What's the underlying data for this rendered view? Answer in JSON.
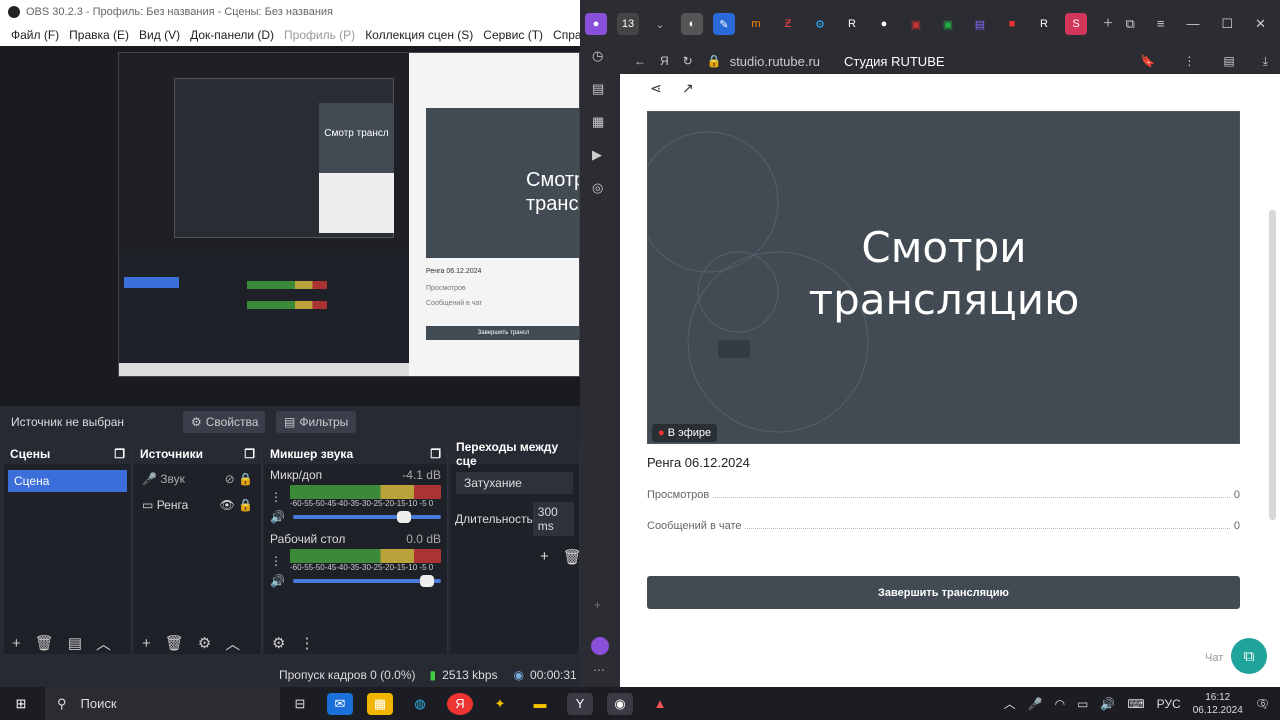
{
  "obs": {
    "title": "OBS 30.2.3 - Профиль: Без названия - Сцены: Без названия",
    "menu": [
      "Файл (F)",
      "Правка (E)",
      "Вид (V)",
      "Док-панели (D)",
      "Профиль (P)",
      "Коллекция сцен (S)",
      "Сервис (T)",
      "Справка"
    ],
    "source_status": "Источник не выбран",
    "properties_btn": "Свойства",
    "filters_btn": "Фильтры",
    "docks": {
      "scenes": {
        "title": "Сцены",
        "items": [
          "Сцена"
        ]
      },
      "sources": {
        "title": "Источники",
        "items": [
          "Звук",
          "Ренга"
        ]
      },
      "mixer": {
        "title": "Микшер звука",
        "channels": [
          {
            "name": "Микр/доп",
            "db": "-4.1 dB",
            "level": 0.8
          },
          {
            "name": "Рабочий стол",
            "db": "0.0 dB",
            "level": 0.95
          }
        ],
        "scale": "-60-55-50-45-40-35-30-25-20-15-10 -5 0"
      },
      "transitions": {
        "title": "Переходы между сце",
        "type": "Затухание",
        "duration_label": "Длительность",
        "duration": "300 ms"
      }
    },
    "status": {
      "dropped": "Пропуск кадров 0 (0.0%)",
      "bitrate": "2513 kbps",
      "time": "00:00:31"
    }
  },
  "browser": {
    "url": "studio.rutube.ru",
    "page_title": "Студия RUTUBE",
    "tab_count": "13",
    "video": {
      "title": "Смотри трансляцию",
      "badge": "В эфире"
    },
    "stream": {
      "name": "Ренга 06.12.2024",
      "views_label": "Просмотров",
      "views": "0",
      "messages_label": "Сообщений в чате",
      "messages": "0"
    },
    "end_button": "Завершить трансляцию",
    "chat_label": "Чат"
  },
  "taskbar": {
    "search": "Поиск",
    "lang": "РУС",
    "time": "16:12",
    "date": "06.12.2024",
    "notif_count": "6"
  },
  "preview": {
    "title": "Смотри трансляцию",
    "date_line": "Ренга 06.12.2024",
    "views_label": "Просмотров",
    "messages_label": "Сообщений в чат",
    "end_button": "Завершить трансл",
    "mini_title": "Смотр трансл"
  }
}
